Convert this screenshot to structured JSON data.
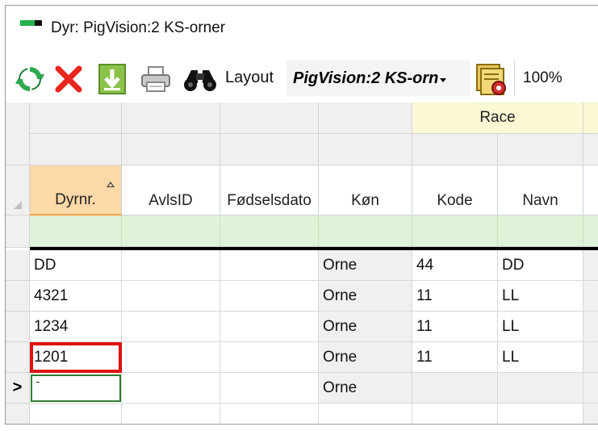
{
  "window": {
    "title": "Dyr: PigVision:2 KS-orner"
  },
  "toolbar": {
    "layout_label": "Layout",
    "layout_value": "PigVision:2 KS-orn",
    "zoom": "100%",
    "icons": [
      "refresh-icon",
      "delete-icon",
      "download-icon",
      "print-icon",
      "binoculars-icon",
      "layout-settings-icon"
    ]
  },
  "grid": {
    "group_header": "Race",
    "columns": [
      "Dyrnr.",
      "AvlsID",
      "Fødselsdato",
      "Køn",
      "Kode",
      "Navn"
    ],
    "sorted_column": "Dyrnr.",
    "rows": [
      {
        "dyrnr": "DD",
        "avlsid": "",
        "fodselsdato": "",
        "kon": "Orne",
        "kode": "44",
        "navn": "DD"
      },
      {
        "dyrnr": "4321",
        "avlsid": "",
        "fodselsdato": "",
        "kon": "Orne",
        "kode": "11",
        "navn": "LL"
      },
      {
        "dyrnr": "1234",
        "avlsid": "",
        "fodselsdato": "",
        "kon": "Orne",
        "kode": "11",
        "navn": "LL"
      },
      {
        "dyrnr": "1201",
        "avlsid": "",
        "fodselsdato": "",
        "kon": "Orne",
        "kode": "11",
        "navn": "LL"
      }
    ],
    "new_row": {
      "indicator": ">",
      "kon": "Orne"
    },
    "highlighted_cell": "1201",
    "colors": {
      "highlight": "#e01010",
      "sorted_header": "#fcd9a8",
      "filter_row": "#dff3d8",
      "race_header": "#fbf8d5"
    }
  }
}
